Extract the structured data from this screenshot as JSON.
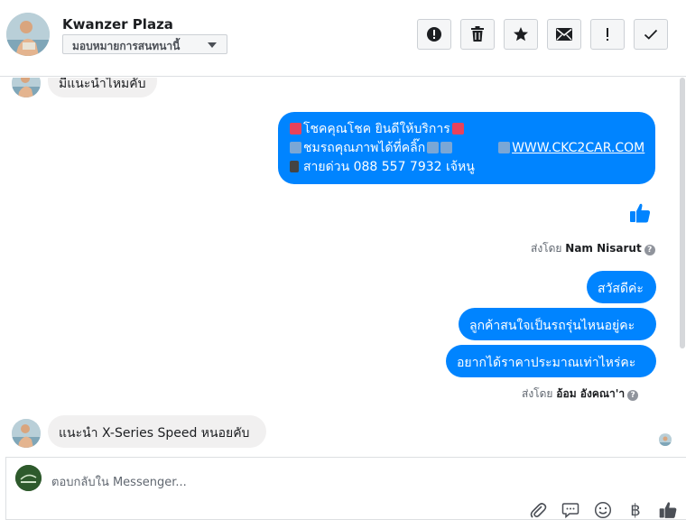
{
  "header": {
    "name": "Kwanzer Plaza",
    "assign_label": "มอบหมายการสนทนานี้"
  },
  "messages": {
    "top_partial": "มีแนะนำไหมคับ",
    "promo": {
      "line1": "โชคคุณโชค ยินดีให้บริการ",
      "line2_text": "ชมรถคุณภาพได้ที่คลิ๊ก",
      "line2_link": "WWW.CKC2CAR.COM",
      "line3": "สายด่วน 088 557 7932 เจ้หนู"
    },
    "sent_by_1_prefix": "ส่งโดย",
    "sent_by_1_name": "Nam Nisarut",
    "out_1": "สวัสดีค่ะ",
    "out_2": "ลูกค้าสนใจเป็นรถรุ่นไหนอยู่คะ",
    "out_3": "อยากได้ราคาประมาณเท่าไหร่คะ",
    "sent_by_2_prefix": "ส่งโดย",
    "sent_by_2_name": "อ้อม อังคณา'า",
    "in_last": "แนะนำ X-Series Speed หนอยคับ"
  },
  "composer": {
    "placeholder": "ตอบกลับใน Messenger...",
    "baht_symbol": "฿"
  },
  "colors": {
    "accent": "#0084ff",
    "incoming_bubble": "#f1f0f0"
  }
}
